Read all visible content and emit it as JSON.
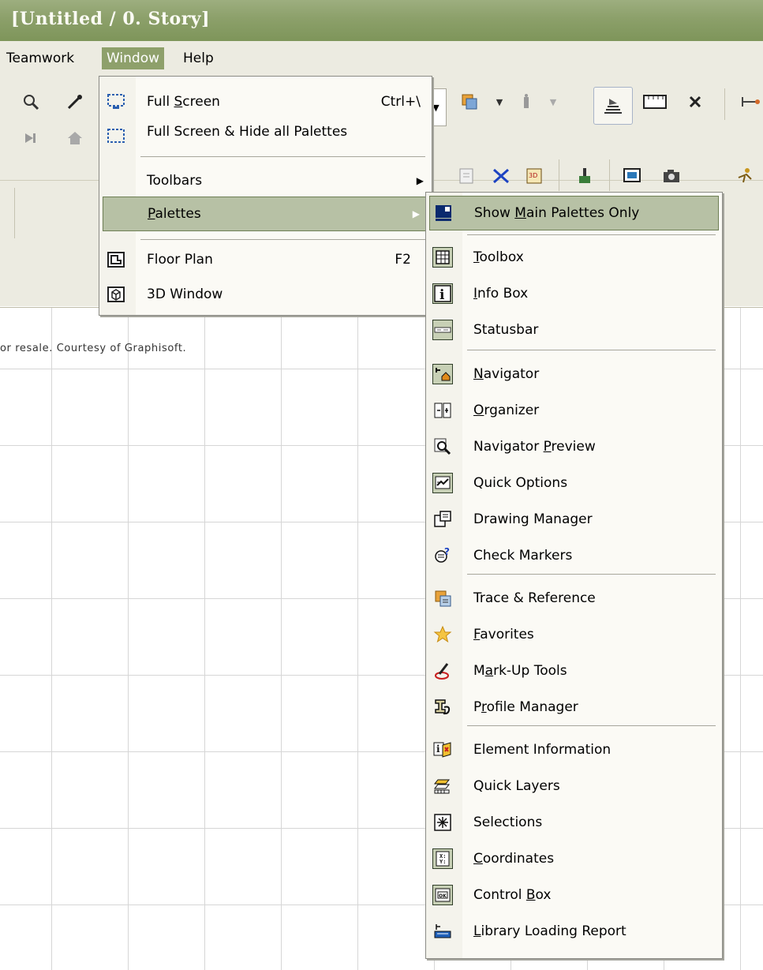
{
  "window": {
    "title": "[Untitled / 0. Story]"
  },
  "menubar": [
    {
      "label": "Teamwork"
    },
    {
      "label": "Window",
      "active": true
    },
    {
      "label": "Help"
    }
  ],
  "canvas": {
    "courtesy_text": "or resale. Courtesy of Graphisoft."
  },
  "window_menu": {
    "full_screen": {
      "pre": "Full ",
      "u": "S",
      "post": "creen",
      "shortcut": "Ctrl+\\"
    },
    "full_screen_hide": {
      "pre": "Full Screen & Hide all Palettes",
      "u": "",
      "post": ""
    },
    "toolbars": {
      "pre": "Toolbars",
      "u": "",
      "post": ""
    },
    "palettes": {
      "pre": "",
      "u": "P",
      "post": "alettes"
    },
    "floor_plan": {
      "pre": "Floor Plan",
      "u": "",
      "post": "",
      "shortcut": "F2"
    },
    "window_3d": {
      "pre": "3D Window",
      "u": "",
      "post": ""
    }
  },
  "palettes_menu": {
    "show_main": {
      "pre": "Show ",
      "u": "M",
      "post": "ain Palettes Only"
    },
    "toolbox": {
      "pre": "",
      "u": "T",
      "post": "oolbox"
    },
    "info_box": {
      "pre": "",
      "u": "I",
      "post": "nfo Box"
    },
    "statusbar": {
      "pre": "Statusbar",
      "u": "",
      "post": ""
    },
    "navigator": {
      "pre": "",
      "u": "N",
      "post": "avigator"
    },
    "organizer": {
      "pre": "",
      "u": "O",
      "post": "rganizer"
    },
    "navigator_preview": {
      "pre": "Navigator ",
      "u": "P",
      "post": "review"
    },
    "quick_options": {
      "pre": "Quick Options",
      "u": "",
      "post": ""
    },
    "drawing_manager": {
      "pre": "Drawing Manager",
      "u": "",
      "post": ""
    },
    "check_markers": {
      "pre": "Check Markers",
      "u": "",
      "post": ""
    },
    "trace_reference": {
      "pre": "Trace & Reference",
      "u": "",
      "post": ""
    },
    "favorites": {
      "pre": "",
      "u": "F",
      "post": "avorites"
    },
    "markup_tools": {
      "pre": "M",
      "u": "a",
      "post": "rk-Up Tools"
    },
    "profile_manager": {
      "pre": "P",
      "u": "r",
      "post": "ofile Manager"
    },
    "element_information": {
      "pre": "Element Information",
      "u": "",
      "post": ""
    },
    "quick_layers": {
      "pre": "Quick Layers",
      "u": "",
      "post": ""
    },
    "selections": {
      "pre": "Selections",
      "u": "",
      "post": ""
    },
    "coordinates": {
      "pre": "",
      "u": "C",
      "post": "oordinates"
    },
    "control_box": {
      "pre": "Control ",
      "u": "B",
      "post": "ox"
    },
    "library_loading_report": {
      "pre": "",
      "u": "L",
      "post": "ibrary Loading Report"
    }
  },
  "colors": {
    "menu_highlight": "#b7c1a5",
    "active_menu": "#8ea06b",
    "titlebar": "#8ca06a"
  }
}
